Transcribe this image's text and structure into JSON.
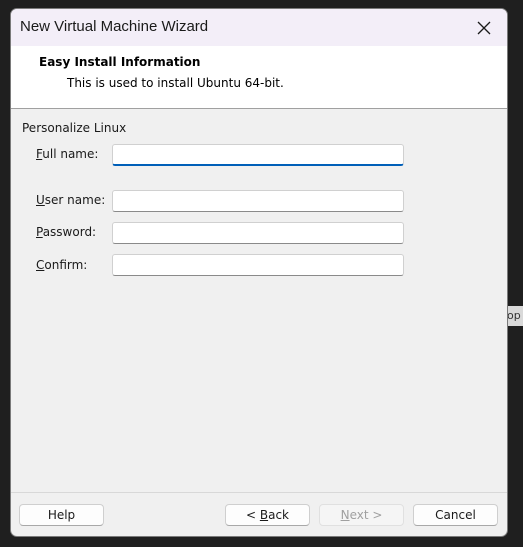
{
  "window": {
    "title": "New Virtual Machine Wizard"
  },
  "header": {
    "title": "Easy Install Information",
    "subtitle": "This is used to install Ubuntu 64-bit."
  },
  "form": {
    "group_label": "Personalize Linux",
    "fields": [
      {
        "label_mnemonic": "F",
        "label_rest": "ull name:",
        "value": ""
      },
      {
        "label_mnemonic": "U",
        "label_rest": "ser name:",
        "value": ""
      },
      {
        "label_mnemonic": "P",
        "label_rest": "assword:",
        "value": ""
      },
      {
        "label_mnemonic": "C",
        "label_rest": "onfirm:",
        "value": ""
      }
    ]
  },
  "footer": {
    "help": "Help",
    "back_prefix": "< ",
    "back_mnemonic": "B",
    "back_rest": "ack",
    "next_mnemonic": "N",
    "next_rest": "ext >",
    "cancel": "Cancel"
  },
  "background": {
    "edge_text": "op"
  },
  "colors": {
    "focus_accent": "#005fb8",
    "titlebar": "#f3eef8"
  },
  "icons": {
    "close": "close-icon"
  }
}
